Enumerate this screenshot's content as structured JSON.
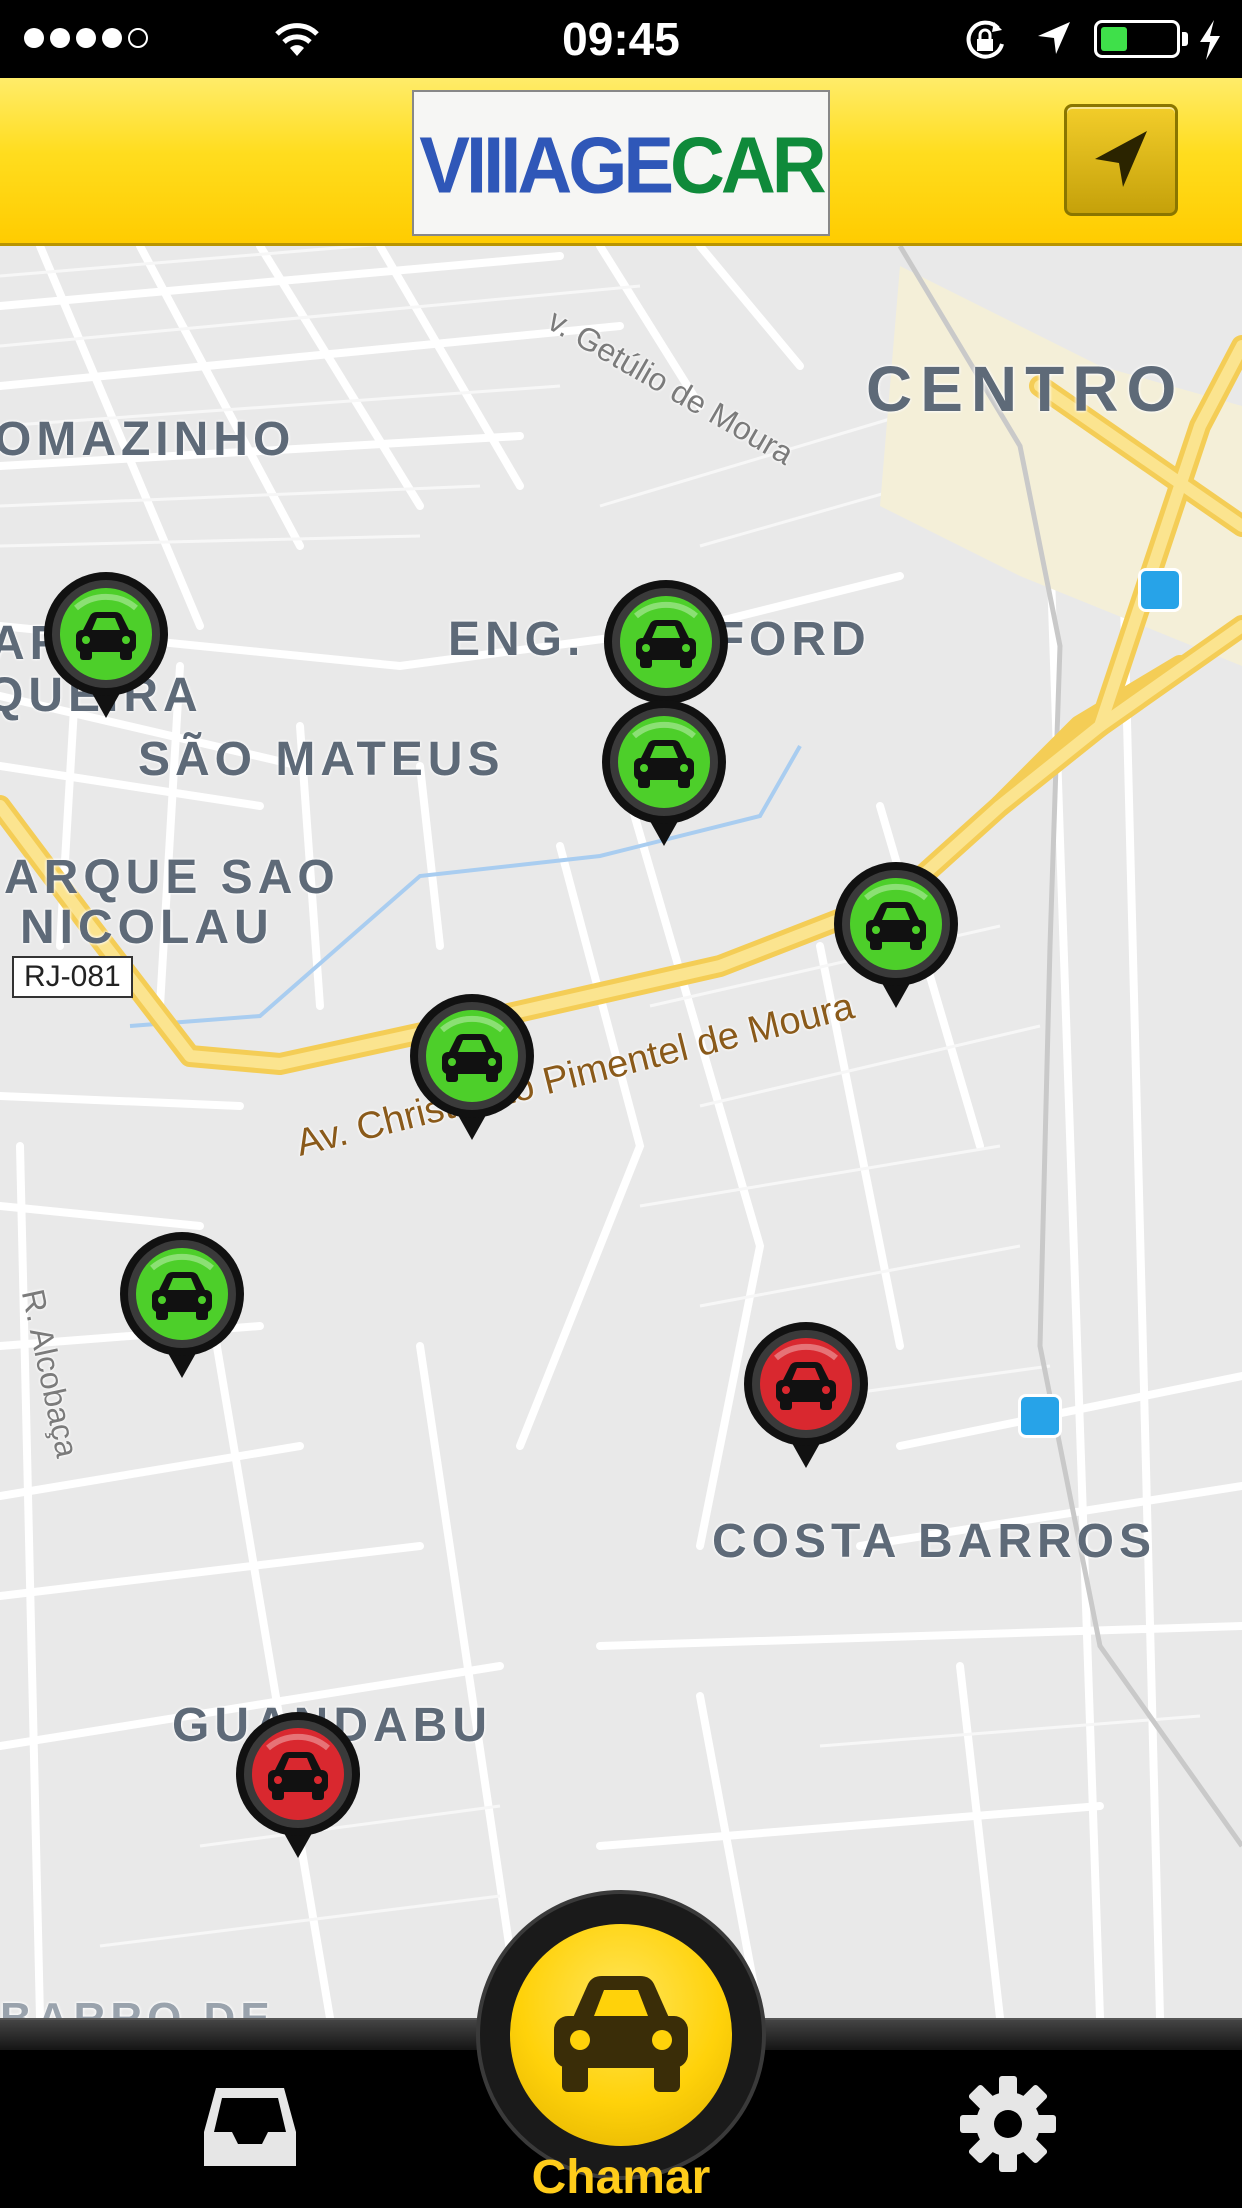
{
  "status_bar": {
    "time": "09:45",
    "signal_bars_filled": 4,
    "signal_bars_total": 5,
    "battery_level": 0.35,
    "battery_color": "#3fe04a"
  },
  "header": {
    "logo_text_a": "VIIIAGE",
    "logo_text_b": "CAR",
    "locate_icon": "location-arrow-icon"
  },
  "map": {
    "neighborhoods": [
      "CENTRO",
      "OMAZINHO",
      "ENG. BELFORD",
      "SÃO MATEUS",
      "ARQUE SAO",
      "NICOLAU",
      "COSTA BARROS",
      "GUANDABU",
      "AR",
      "QUEIRA",
      "BARRO DE"
    ],
    "streets": {
      "getulio": "v. Getúlio de Moura",
      "alcobaca": "R. Alcobaça",
      "avenue": "Av. Christóvão Pimentel de Moura"
    },
    "road_shield": "RJ-081",
    "driver_pins": [
      {
        "status": "available",
        "color": "#4dcf2a"
      },
      {
        "status": "available",
        "color": "#4dcf2a"
      },
      {
        "status": "available",
        "color": "#4dcf2a"
      },
      {
        "status": "available",
        "color": "#4dcf2a"
      },
      {
        "status": "available",
        "color": "#4dcf2a"
      },
      {
        "status": "available",
        "color": "#4dcf2a"
      },
      {
        "status": "busy",
        "color": "#d9282f"
      },
      {
        "status": "busy",
        "color": "#d9282f"
      }
    ]
  },
  "bottom_bar": {
    "inbox_icon": "inbox-icon",
    "call_label": "Chamar",
    "settings_icon": "gear-icon",
    "accent": "#ffcc1a"
  }
}
